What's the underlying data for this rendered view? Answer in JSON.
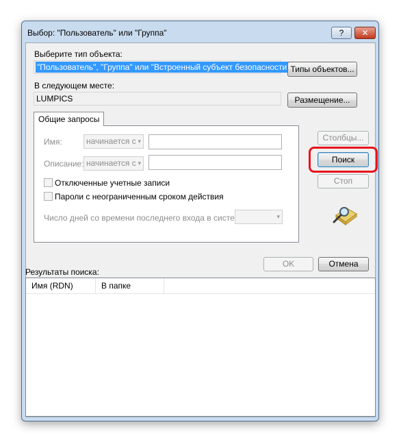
{
  "window": {
    "title": "Выбор: \"Пользователь\" или \"Группа\"",
    "help_glyph": "?",
    "close_glyph": "✕"
  },
  "object_type": {
    "label": "Выберите тип объекта:",
    "value": "\"Пользователь\", \"Группа\" или \"Встроенный субъект безопасности\"",
    "button": "Типы объектов..."
  },
  "location": {
    "label": "В следующем месте:",
    "value": "LUMPICS",
    "button": "Размещение..."
  },
  "tab": {
    "label": "Общие запросы"
  },
  "query": {
    "name_label": "Имя:",
    "name_mode": "начинается с",
    "desc_label": "Описание:",
    "desc_mode": "начинается с",
    "disabled_accounts": "Отключенные учетные записи",
    "no_expire_passwords": "Пароли с неограниченным сроком действия",
    "days_label": "Число дней со времени последнего входа в систему:"
  },
  "side_buttons": {
    "columns": "Столбцы...",
    "search": "Поиск",
    "stop": "Стоп"
  },
  "footer": {
    "ok": "OK",
    "cancel": "Отмена",
    "results_label": "Результаты поиска:"
  },
  "results": {
    "columns": [
      "Имя (RDN)",
      "В папке"
    ]
  },
  "icons": {
    "search_icon": "magnifier-folder-icon",
    "arrow": "▾"
  },
  "colors": {
    "highlight": "#e8141a",
    "selection": "#3399ff"
  }
}
